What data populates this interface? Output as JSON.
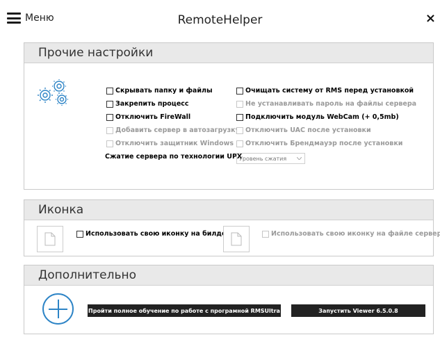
{
  "topbar": {
    "menu_label": "Меню",
    "title": "RemoteHelper",
    "close_label": "×"
  },
  "other_settings": {
    "header": "Прочие настройки",
    "left_options": [
      {
        "label": "Скрывать папку и файлы",
        "enabled": true,
        "checked": false
      },
      {
        "label": "Закрепить процесс",
        "enabled": true,
        "checked": false
      },
      {
        "label": "Отключить FireWall",
        "enabled": true,
        "checked": false
      },
      {
        "label": "Добавить сервер в автозагрузку",
        "enabled": false,
        "checked": false
      },
      {
        "label": "Отключить защитник Windows",
        "enabled": false,
        "checked": false
      }
    ],
    "right_options": [
      {
        "label": "Очищать систему от RMS перед установкой",
        "enabled": true,
        "checked": false
      },
      {
        "label": "Не устанавливать пароль на файлы сервера",
        "enabled": false,
        "checked": false
      },
      {
        "label": "Подключить модуль WebCam (+ 0,5mb)",
        "enabled": true,
        "checked": false
      },
      {
        "label": "Отключить UAC после установки",
        "enabled": false,
        "checked": false
      },
      {
        "label": "Отключить Брендмауэр после установки",
        "enabled": false,
        "checked": false
      }
    ],
    "upx_label": "Сжатие сервера по технологии UPX",
    "compression_select": "Уровень сжатия"
  },
  "icon_section": {
    "header": "Иконка",
    "use_icon_build": "Использовать свою иконку на билде",
    "use_icon_server": "Использовать свою иконку на файле сервера"
  },
  "extra_section": {
    "header": "Дополнительно",
    "training_button": "Пройти полное обучение по работе с програмной RMSUltra",
    "viewer_button": "Запустить Viewer 6.5.0.8"
  },
  "colors": {
    "accent_blue": "#2d84c6",
    "header_bg": "#e9e9e9",
    "dark_button": "#222222",
    "disabled_text": "#9a9a9a"
  }
}
